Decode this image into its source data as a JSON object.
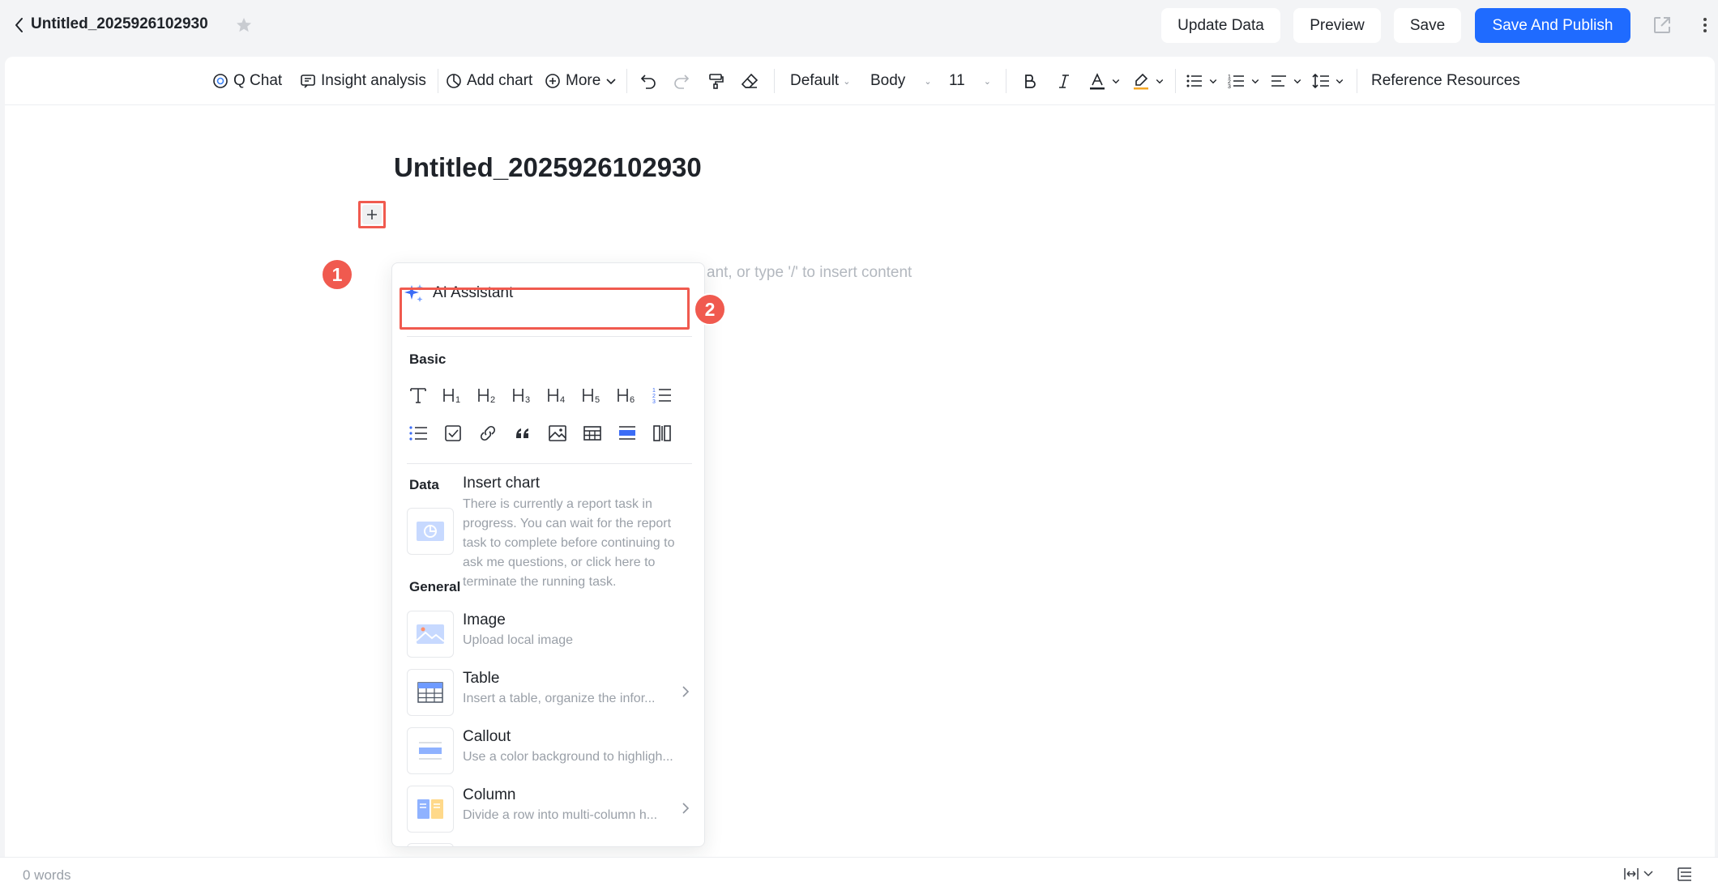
{
  "header": {
    "doc_title": "Untitled_2025926102930",
    "buttons": {
      "update_data": "Update Data",
      "preview": "Preview",
      "save": "Save",
      "save_publish": "Save And Publish"
    },
    "accent_color": "#1f6bff"
  },
  "toolbar": {
    "q_chat": "Q Chat",
    "insight": "Insight analysis",
    "add_chart": "Add chart",
    "more": "More",
    "style": "Default",
    "paragraph": "Body",
    "font_size": "11",
    "reference": "Reference Resources"
  },
  "document": {
    "title": "Untitled_2025926102930",
    "placeholder": "ant, or type '/' to insert content"
  },
  "annotations": {
    "step1": "1",
    "step2": "2",
    "highlight_color": "#f05a4f"
  },
  "menu": {
    "ai_assistant": "AI Assistant",
    "basic_label": "Basic",
    "basic_icons_row1": [
      "text-icon",
      "heading1-icon",
      "heading2-icon",
      "heading3-icon",
      "heading4-icon",
      "heading5-icon",
      "heading6-icon",
      "ordered-list-icon"
    ],
    "basic_icons_row2": [
      "bullet-list-icon",
      "checklist-icon",
      "link-icon",
      "quote-icon",
      "image-icon",
      "table-icon",
      "callout-icon",
      "column-icon"
    ],
    "data_label": "Data",
    "insert_chart": {
      "title": "Insert chart",
      "desc": "There is currently a report task in progress. You can wait for the report task to complete before continuing to ask me questions, or click here to terminate the running task."
    },
    "general_label": "General",
    "items": [
      {
        "title": "Image",
        "desc": "Upload local image"
      },
      {
        "title": "Table",
        "desc": "Insert a table, organize the infor..."
      },
      {
        "title": "Callout",
        "desc": "Use a color background to highligh..."
      },
      {
        "title": "Column",
        "desc": "Divide a row into multi-column h..."
      }
    ]
  },
  "status": {
    "word_count": "0 words"
  }
}
